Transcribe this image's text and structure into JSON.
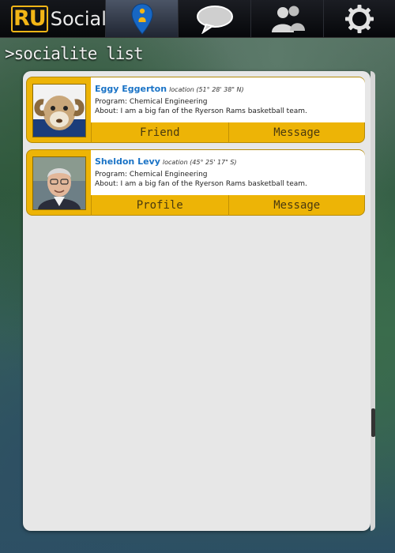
{
  "app": {
    "logo_ru": "RU",
    "logo_social": "Social"
  },
  "nav": {
    "tabs": [
      {
        "icon": "location-pin-icon",
        "active": true
      },
      {
        "icon": "chat-bubble-icon",
        "active": false
      },
      {
        "icon": "people-icon",
        "active": false
      },
      {
        "icon": "gear-icon",
        "active": false
      }
    ]
  },
  "page": {
    "title": ">socialite list"
  },
  "list": [
    {
      "name": "Eggy Eggerton",
      "location": "location (51° 28' 38\" N)",
      "program": "Program: Chemical Engineering",
      "about": "About: I am a big fan of the Ryerson Rams basketball team.",
      "actions": [
        "Friend",
        "Message"
      ]
    },
    {
      "name": "Sheldon Levy",
      "location": "location (45° 25' 17\" S)",
      "program": "Program: Chemical Engineering",
      "about": "About: I am a big fan of the Ryerson Rams basketball team.",
      "actions": [
        "Profile",
        "Message"
      ]
    }
  ],
  "colors": {
    "accent": "#edb406",
    "brand_yellow": "#f2b516",
    "name_blue": "#1a73c6"
  }
}
